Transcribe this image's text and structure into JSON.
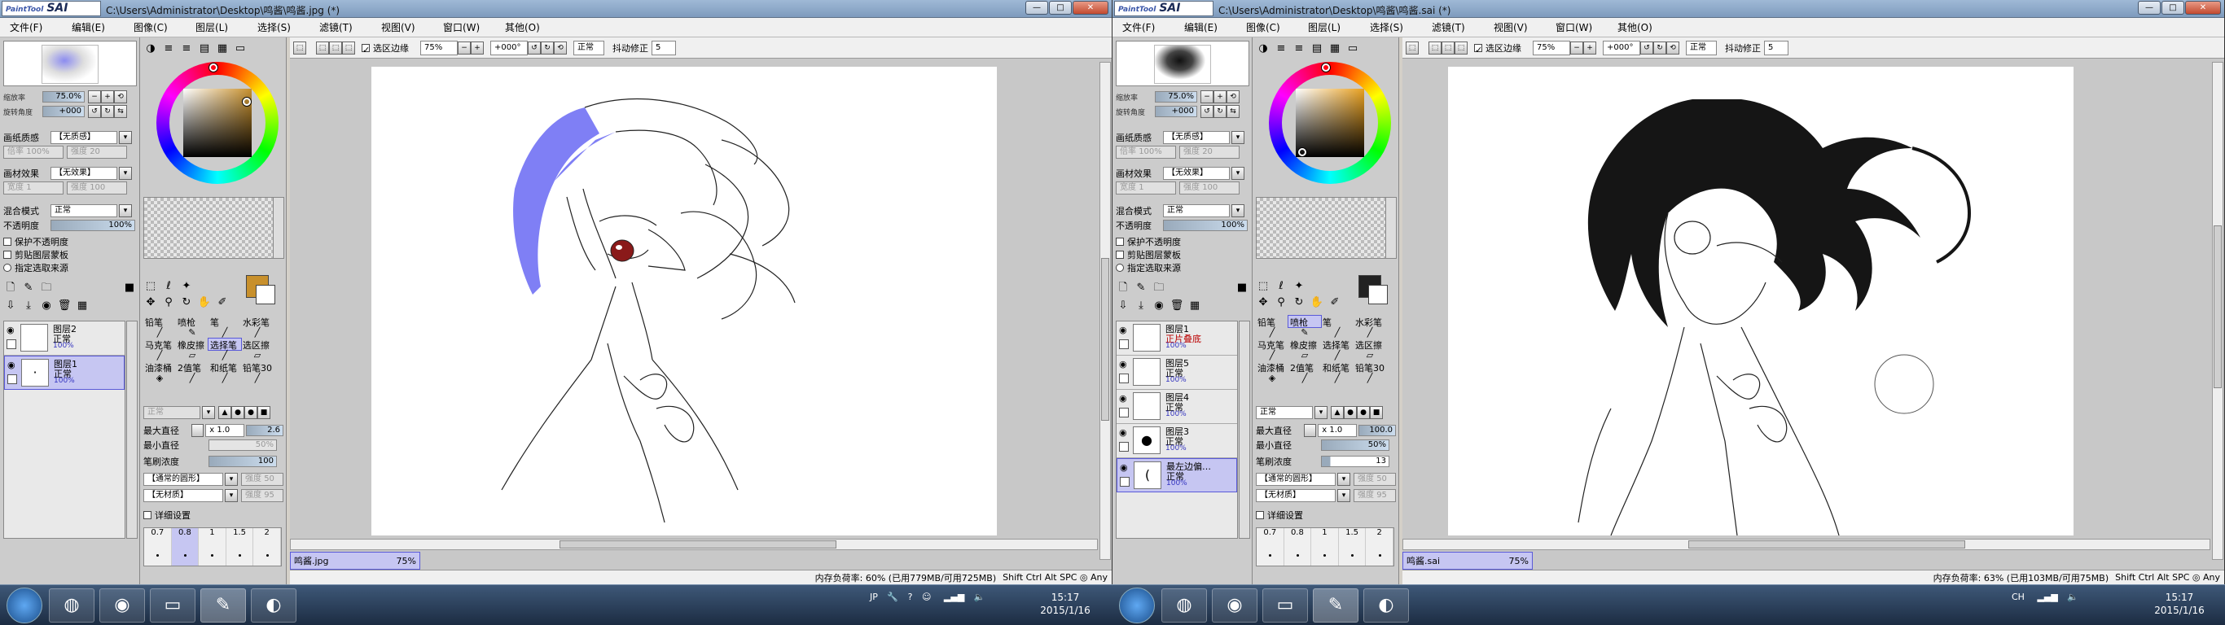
{
  "windows": [
    {
      "id": "w1",
      "app_logo": "PaintTool SAI",
      "title": "C:\\Users\\Administrator\\Desktop\\鸣酱\\鸣酱.jpg (*)",
      "menu": [
        "文件(F)",
        "编辑(E)",
        "图像(C)",
        "图层(L)",
        "选择(S)",
        "滤镜(T)",
        "视图(V)",
        "窗口(W)",
        "其他(O)"
      ],
      "nav": {
        "zoom_label": "缩放率",
        "zoom": "75.0%",
        "angle_label": "旋转角度",
        "angle": "+000"
      },
      "paper_texture": {
        "label": "画纸质感",
        "value": "【无质感】",
        "scale": "倍率",
        "scale_val": "100%",
        "strength": "强度",
        "strength_val": "20"
      },
      "paper_effect": {
        "label": "画材效果",
        "value": "【无效果】",
        "width": "宽度",
        "width_val": "1",
        "strength": "强度",
        "strength_val": "100"
      },
      "blend": {
        "label": "混合模式",
        "value": "正常"
      },
      "opacity": {
        "label": "不透明度",
        "value": "100%"
      },
      "checks": [
        "保护不透明度",
        "剪贴图层蒙板",
        "指定选取来源"
      ],
      "layers": [
        {
          "name": "图层2",
          "mode": "正常",
          "pct": "100%",
          "selected": false
        },
        {
          "name": "图层1",
          "mode": "正常",
          "pct": "100%",
          "selected": true
        }
      ],
      "color": {
        "fg": "#c8902c"
      },
      "tools": [
        [
          "铅笔",
          "喷枪",
          "笔",
          "水彩笔"
        ],
        [
          "马克笔",
          "橡皮擦",
          "选择笔",
          "选区擦"
        ],
        [
          "油漆桶",
          "2值笔",
          "和纸笔",
          "铅笔30"
        ]
      ],
      "selected_tool": "选择笔",
      "brush": {
        "mode": "正常",
        "max_label": "最大直径",
        "max_mult": "x 1.0",
        "max_val": "2.6",
        "min_label": "最小直径",
        "min_val": "50%",
        "density_label": "笔刷浓度",
        "density_val": "100",
        "shape": "【通常的圆形】",
        "shape_str": "强度",
        "shape_str_val": "50",
        "texture": "【无材质】",
        "texture_str": "强度",
        "texture_str_val": "95",
        "detail": "详细设置"
      },
      "sizes": [
        "0.7",
        "0.8",
        "1",
        "1.5",
        "2"
      ],
      "canvas_toolbar": {
        "sel_edge": "选区边缘",
        "zoom": "75%",
        "angle": "+000°",
        "mode": "正常",
        "stab_label": "抖动修正",
        "stab": "5"
      },
      "doc_tab": {
        "name": "鸣酱.jpg",
        "zoom": "75%"
      },
      "status": {
        "memory": "内存负荷率: 60% (已用779MB/可用725MB)",
        "keys": "Shift Ctrl Alt SPC ◎ Any"
      }
    },
    {
      "id": "w2",
      "app_logo": "PaintTool SAI",
      "title": "C:\\Users\\Administrator\\Desktop\\鸣酱\\鸣酱.sai (*)",
      "menu": [
        "文件(F)",
        "编辑(E)",
        "图像(C)",
        "图层(L)",
        "选择(S)",
        "滤镜(T)",
        "视图(V)",
        "窗口(W)",
        "其他(O)"
      ],
      "nav": {
        "zoom_label": "缩放率",
        "zoom": "75.0%",
        "angle_label": "旋转角度",
        "angle": "+000"
      },
      "paper_texture": {
        "label": "画纸质感",
        "value": "【无质感】",
        "scale": "倍率",
        "scale_val": "100%",
        "strength": "强度",
        "strength_val": "20"
      },
      "paper_effect": {
        "label": "画材效果",
        "value": "【无效果】",
        "width": "宽度",
        "width_val": "1",
        "strength": "强度",
        "strength_val": "100"
      },
      "blend": {
        "label": "混合模式",
        "value": "正常"
      },
      "opacity": {
        "label": "不透明度",
        "value": "100%"
      },
      "checks": [
        "保护不透明度",
        "剪贴图层蒙板",
        "指定选取来源"
      ],
      "layers": [
        {
          "name": "图层1",
          "mode": "正片叠底",
          "pct": "100%",
          "selected": false
        },
        {
          "name": "图层5",
          "mode": "正常",
          "pct": "100%",
          "selected": false
        },
        {
          "name": "图层4",
          "mode": "正常",
          "pct": "100%",
          "selected": false
        },
        {
          "name": "图层3",
          "mode": "正常",
          "pct": "100%",
          "selected": false
        },
        {
          "name": "最左边偏…",
          "mode": "正常",
          "pct": "100%",
          "selected": true
        }
      ],
      "color": {
        "fg": "#222222"
      },
      "tools": [
        [
          "铅笔",
          "喷枪",
          "笔",
          "水彩笔"
        ],
        [
          "马克笔",
          "橡皮擦",
          "选择笔",
          "选区擦"
        ],
        [
          "油漆桶",
          "2值笔",
          "和纸笔",
          "铅笔30"
        ]
      ],
      "selected_tool": "喷枪",
      "brush": {
        "mode": "正常",
        "max_label": "最大直径",
        "max_mult": "x 1.0",
        "max_val": "100.0",
        "min_label": "最小直径",
        "min_val": "50%",
        "density_label": "笔刷浓度",
        "density_val": "13",
        "shape": "【通常的圆形】",
        "shape_str": "强度",
        "shape_str_val": "50",
        "texture": "【无材质】",
        "texture_str": "强度",
        "texture_str_val": "95",
        "detail": "详细设置"
      },
      "sizes": [
        "0.7",
        "0.8",
        "1",
        "1.5",
        "2"
      ],
      "canvas_toolbar": {
        "sel_edge": "选区边缘",
        "zoom": "75%",
        "angle": "+000°",
        "mode": "正常",
        "stab_label": "抖动修正",
        "stab": "5"
      },
      "doc_tab": {
        "name": "鸣酱.sai",
        "zoom": "75%"
      },
      "status": {
        "memory": "内存负荷率: 63% (已用103MB/可用75MB)",
        "keys": "Shift Ctrl Alt SPC ◎ Any"
      }
    }
  ],
  "taskbar": {
    "left_tray": [
      "JP",
      "🔧",
      "?",
      "☺"
    ],
    "left_clock": {
      "time": "15:17",
      "date": "2015/1/16"
    },
    "right_tray": [
      "CH"
    ],
    "right_clock": {
      "time": "15:17",
      "date": "2015/1/16"
    },
    "apps": [
      "chrome",
      "netease-music",
      "folder",
      "sai",
      "app5"
    ]
  }
}
